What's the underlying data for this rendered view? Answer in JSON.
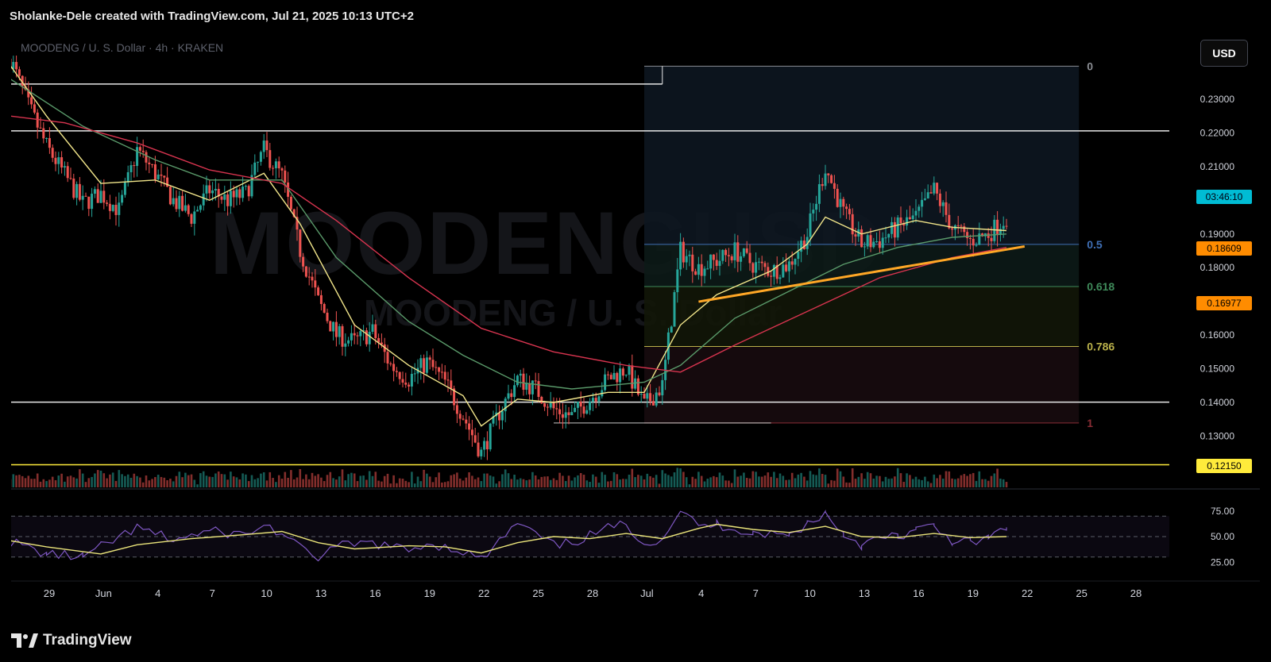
{
  "header": {
    "credit": "Sholanke-Dele created with TradingView.com, Jul 21, 2025 10:13 UTC+2"
  },
  "symbol_title": "MOODENG / U. S. Dollar · 4h · KRAKEN",
  "watermark": {
    "ticker": "MOODENGUSD",
    "name": "MOODENG / U. S. Dollar"
  },
  "currency_label": "USD",
  "price_tags": {
    "countdown": "03:46:10",
    "last_price": "0.18609",
    "fib_618": "0.16977",
    "support": "0.12150"
  },
  "footer": {
    "brand": "TradingView"
  },
  "colors": {
    "up": "#26a69a",
    "down": "#ef5350",
    "ema_fast": "#f1e58a",
    "ema_mid": "#5a9a6a",
    "ema_slow": "#d8344f",
    "trendline": "#ffa726",
    "rsi": "#7e57c2",
    "rsi_ma": "#e9e37a"
  },
  "chart_data": {
    "type": "candlestick",
    "symbol": "MOODENG / U. S. Dollar",
    "interval": "4h",
    "exchange": "KRAKEN",
    "date_axis_labels": [
      "29",
      "Jun",
      "4",
      "7",
      "10",
      "13",
      "16",
      "19",
      "22",
      "25",
      "28",
      "Jul",
      "4",
      "7",
      "10",
      "13",
      "16",
      "19",
      "22",
      "25",
      "28"
    ],
    "price_axis_labels": [
      "0.23000",
      "0.22000",
      "0.21000",
      "0.19000",
      "0.18000",
      "0.16000",
      "0.15000",
      "0.14000",
      "0.13000"
    ],
    "ylim": [
      0.119,
      0.243
    ],
    "price_path": [
      {
        "x": "May 27",
        "y": 0.242
      },
      {
        "x": "May 28",
        "y": 0.228
      },
      {
        "x": "May 29",
        "y": 0.216
      },
      {
        "x": "May 31",
        "y": 0.199
      },
      {
        "x": "Jun 1",
        "y": 0.202
      },
      {
        "x": "Jun 2",
        "y": 0.197
      },
      {
        "x": "Jun 3",
        "y": 0.215
      },
      {
        "x": "Jun 4",
        "y": 0.208
      },
      {
        "x": "Jun 5",
        "y": 0.2
      },
      {
        "x": "Jun 6",
        "y": 0.195
      },
      {
        "x": "Jun 7",
        "y": 0.203
      },
      {
        "x": "Jun 8",
        "y": 0.2
      },
      {
        "x": "Jun 9",
        "y": 0.202
      },
      {
        "x": "Jun 10",
        "y": 0.215
      },
      {
        "x": "Jun 11",
        "y": 0.207
      },
      {
        "x": "Jun 12",
        "y": 0.185
      },
      {
        "x": "Jun 13",
        "y": 0.17
      },
      {
        "x": "Jun 14",
        "y": 0.16
      },
      {
        "x": "Jun 15",
        "y": 0.158
      },
      {
        "x": "Jun 16",
        "y": 0.161
      },
      {
        "x": "Jun 17",
        "y": 0.151
      },
      {
        "x": "Jun 18",
        "y": 0.147
      },
      {
        "x": "Jun 19",
        "y": 0.152
      },
      {
        "x": "Jun 20",
        "y": 0.146
      },
      {
        "x": "Jun 21",
        "y": 0.136
      },
      {
        "x": "Jun 22",
        "y": 0.125
      },
      {
        "x": "Jun 23",
        "y": 0.137
      },
      {
        "x": "Jun 24",
        "y": 0.147
      },
      {
        "x": "Jun 25",
        "y": 0.144
      },
      {
        "x": "Jun 26",
        "y": 0.138
      },
      {
        "x": "Jun 27",
        "y": 0.136
      },
      {
        "x": "Jun 28",
        "y": 0.141
      },
      {
        "x": "Jun 29",
        "y": 0.147
      },
      {
        "x": "Jun 30",
        "y": 0.15
      },
      {
        "x": "Jul 1",
        "y": 0.139
      },
      {
        "x": "Jul 2",
        "y": 0.145
      },
      {
        "x": "Jul 3",
        "y": 0.185
      },
      {
        "x": "Jul 4",
        "y": 0.18
      },
      {
        "x": "Jul 5",
        "y": 0.182
      },
      {
        "x": "Jul 6",
        "y": 0.185
      },
      {
        "x": "Jul 7",
        "y": 0.181
      },
      {
        "x": "Jul 8",
        "y": 0.179
      },
      {
        "x": "Jul 9",
        "y": 0.181
      },
      {
        "x": "Jul 10",
        "y": 0.19
      },
      {
        "x": "Jul 11",
        "y": 0.21
      },
      {
        "x": "Jul 12",
        "y": 0.196
      },
      {
        "x": "Jul 13",
        "y": 0.187
      },
      {
        "x": "Jul 14",
        "y": 0.188
      },
      {
        "x": "Jul 15",
        "y": 0.192
      },
      {
        "x": "Jul 16",
        "y": 0.195
      },
      {
        "x": "Jul 17",
        "y": 0.203
      },
      {
        "x": "Jul 18",
        "y": 0.192
      },
      {
        "x": "Jul 19",
        "y": 0.188
      },
      {
        "x": "Jul 20",
        "y": 0.19
      },
      {
        "x": "Jul 21",
        "y": 0.195
      }
    ],
    "moving_averages": [
      {
        "color": "#f1e58a",
        "points": [
          {
            "x": "May 27",
            "y": 0.24
          },
          {
            "x": "May 29",
            "y": 0.225
          },
          {
            "x": "Jun 1",
            "y": 0.205
          },
          {
            "x": "Jun 4",
            "y": 0.206
          },
          {
            "x": "Jun 7",
            "y": 0.2
          },
          {
            "x": "Jun 10",
            "y": 0.208
          },
          {
            "x": "Jun 12",
            "y": 0.193
          },
          {
            "x": "Jun 15",
            "y": 0.163
          },
          {
            "x": "Jun 18",
            "y": 0.151
          },
          {
            "x": "Jun 21",
            "y": 0.142
          },
          {
            "x": "Jun 22",
            "y": 0.133
          },
          {
            "x": "Jun 24",
            "y": 0.141
          },
          {
            "x": "Jun 26",
            "y": 0.14
          },
          {
            "x": "Jun 29",
            "y": 0.143
          },
          {
            "x": "Jul 1",
            "y": 0.143
          },
          {
            "x": "Jul 3",
            "y": 0.163
          },
          {
            "x": "Jul 5",
            "y": 0.172
          },
          {
            "x": "Jul 8",
            "y": 0.179
          },
          {
            "x": "Jul 10",
            "y": 0.187
          },
          {
            "x": "Jul 11",
            "y": 0.195
          },
          {
            "x": "Jul 13",
            "y": 0.19
          },
          {
            "x": "Jul 16",
            "y": 0.194
          },
          {
            "x": "Jul 18",
            "y": 0.192
          },
          {
            "x": "Jul 21",
            "y": 0.191
          }
        ]
      },
      {
        "color": "#5a9a6a",
        "points": [
          {
            "x": "May 27",
            "y": 0.236
          },
          {
            "x": "May 31",
            "y": 0.222
          },
          {
            "x": "Jun 4",
            "y": 0.212
          },
          {
            "x": "Jun 7",
            "y": 0.206
          },
          {
            "x": "Jun 11",
            "y": 0.206
          },
          {
            "x": "Jun 14",
            "y": 0.183
          },
          {
            "x": "Jun 18",
            "y": 0.164
          },
          {
            "x": "Jun 21",
            "y": 0.154
          },
          {
            "x": "Jun 24",
            "y": 0.146
          },
          {
            "x": "Jun 27",
            "y": 0.144
          },
          {
            "x": "Jul 1",
            "y": 0.146
          },
          {
            "x": "Jul 3",
            "y": 0.151
          },
          {
            "x": "Jul 6",
            "y": 0.165
          },
          {
            "x": "Jul 9",
            "y": 0.173
          },
          {
            "x": "Jul 12",
            "y": 0.181
          },
          {
            "x": "Jul 15",
            "y": 0.186
          },
          {
            "x": "Jul 18",
            "y": 0.189
          },
          {
            "x": "Jul 21",
            "y": 0.19
          }
        ]
      },
      {
        "color": "#d8344f",
        "points": [
          {
            "x": "May 27",
            "y": 0.225
          },
          {
            "x": "May 30",
            "y": 0.223
          },
          {
            "x": "Jun 3",
            "y": 0.217
          },
          {
            "x": "Jun 7",
            "y": 0.209
          },
          {
            "x": "Jun 11",
            "y": 0.205
          },
          {
            "x": "Jun 14",
            "y": 0.194
          },
          {
            "x": "Jun 18",
            "y": 0.177
          },
          {
            "x": "Jun 22",
            "y": 0.162
          },
          {
            "x": "Jun 26",
            "y": 0.155
          },
          {
            "x": "Jun 30",
            "y": 0.151
          },
          {
            "x": "Jul 3",
            "y": 0.149
          },
          {
            "x": "Jul 6",
            "y": 0.157
          },
          {
            "x": "Jul 10",
            "y": 0.167
          },
          {
            "x": "Jul 14",
            "y": 0.177
          },
          {
            "x": "Jul 18",
            "y": 0.183
          },
          {
            "x": "Jul 21",
            "y": 0.186
          }
        ]
      }
    ],
    "horizontal_levels": [
      0.2345,
      0.2206,
      0.1401,
      0.1215
    ],
    "trendline": {
      "from": {
        "x": "Jul 4",
        "y": 0.1699
      },
      "to": {
        "x": "Jul 22",
        "y": 0.1863
      }
    },
    "fibonacci": {
      "high": 0.2398,
      "low": 0.1339,
      "start": "Jul 1",
      "end": "Jul 25",
      "levels": [
        {
          "label": "0",
          "price": 0.2398
        },
        {
          "label": "0.5",
          "price": 0.1869
        },
        {
          "label": "0.618",
          "price": 0.1744
        },
        {
          "label": "0.786",
          "price": 0.1566
        },
        {
          "label": "1",
          "price": 0.1339
        }
      ]
    },
    "low_marker": {
      "price": 0.1339,
      "from": "Jun 26",
      "to": "Jul 8"
    },
    "rsi": {
      "axis_labels": [
        "75.00",
        "50.00",
        "25.00"
      ],
      "ylim": [
        15,
        85
      ],
      "bands": [
        70,
        50,
        30
      ],
      "rsi_values": [
        {
          "x": "May 27",
          "y": 45
        },
        {
          "x": "May 29",
          "y": 33
        },
        {
          "x": "May 31",
          "y": 30
        },
        {
          "x": "Jun 1",
          "y": 40
        },
        {
          "x": "Jun 3",
          "y": 58
        },
        {
          "x": "Jun 5",
          "y": 47
        },
        {
          "x": "Jun 7",
          "y": 55
        },
        {
          "x": "Jun 9",
          "y": 52
        },
        {
          "x": "Jun 10",
          "y": 61
        },
        {
          "x": "Jun 11",
          "y": 53
        },
        {
          "x": "Jun 12",
          "y": 38
        },
        {
          "x": "Jun 13",
          "y": 30
        },
        {
          "x": "Jun 14",
          "y": 40
        },
        {
          "x": "Jun 16",
          "y": 44
        },
        {
          "x": "Jun 18",
          "y": 36
        },
        {
          "x": "Jun 19",
          "y": 44
        },
        {
          "x": "Jun 20",
          "y": 40
        },
        {
          "x": "Jun 21",
          "y": 36
        },
        {
          "x": "Jun 22",
          "y": 27
        },
        {
          "x": "Jun 23",
          "y": 45
        },
        {
          "x": "Jun 24",
          "y": 63
        },
        {
          "x": "Jun 25",
          "y": 52
        },
        {
          "x": "Jun 26",
          "y": 41
        },
        {
          "x": "Jun 27",
          "y": 44
        },
        {
          "x": "Jun 29",
          "y": 58
        },
        {
          "x": "Jun 30",
          "y": 62
        },
        {
          "x": "Jul 1",
          "y": 44
        },
        {
          "x": "Jul 2",
          "y": 48
        },
        {
          "x": "Jul 3",
          "y": 77
        },
        {
          "x": "Jul 4",
          "y": 59
        },
        {
          "x": "Jul 5",
          "y": 62
        },
        {
          "x": "Jul 7",
          "y": 54
        },
        {
          "x": "Jul 9",
          "y": 51
        },
        {
          "x": "Jul 10",
          "y": 63
        },
        {
          "x": "Jul 11",
          "y": 73
        },
        {
          "x": "Jul 12",
          "y": 53
        },
        {
          "x": "Jul 13",
          "y": 42
        },
        {
          "x": "Jul 14",
          "y": 48
        },
        {
          "x": "Jul 15",
          "y": 50
        },
        {
          "x": "Jul 16",
          "y": 56
        },
        {
          "x": "Jul 17",
          "y": 60
        },
        {
          "x": "Jul 18",
          "y": 46
        },
        {
          "x": "Jul 19",
          "y": 44
        },
        {
          "x": "Jul 20",
          "y": 48
        },
        {
          "x": "Jul 21",
          "y": 59
        }
      ],
      "rsi_ma_values": [
        {
          "x": "May 27",
          "y": 46
        },
        {
          "x": "May 29",
          "y": 40
        },
        {
          "x": "Jun 1",
          "y": 33
        },
        {
          "x": "Jun 3",
          "y": 42
        },
        {
          "x": "Jun 6",
          "y": 48
        },
        {
          "x": "Jun 9",
          "y": 52
        },
        {
          "x": "Jun 11",
          "y": 55
        },
        {
          "x": "Jun 13",
          "y": 44
        },
        {
          "x": "Jun 15",
          "y": 38
        },
        {
          "x": "Jun 18",
          "y": 41
        },
        {
          "x": "Jun 20",
          "y": 40
        },
        {
          "x": "Jun 22",
          "y": 34
        },
        {
          "x": "Jun 24",
          "y": 44
        },
        {
          "x": "Jun 26",
          "y": 50
        },
        {
          "x": "Jun 28",
          "y": 48
        },
        {
          "x": "Jun 30",
          "y": 53
        },
        {
          "x": "Jul 2",
          "y": 48
        },
        {
          "x": "Jul 4",
          "y": 58
        },
        {
          "x": "Jul 5",
          "y": 62
        },
        {
          "x": "Jul 7",
          "y": 57
        },
        {
          "x": "Jul 9",
          "y": 54
        },
        {
          "x": "Jul 11",
          "y": 60
        },
        {
          "x": "Jul 13",
          "y": 50
        },
        {
          "x": "Jul 15",
          "y": 49
        },
        {
          "x": "Jul 17",
          "y": 53
        },
        {
          "x": "Jul 19",
          "y": 49
        },
        {
          "x": "Jul 21",
          "y": 50
        }
      ]
    }
  }
}
